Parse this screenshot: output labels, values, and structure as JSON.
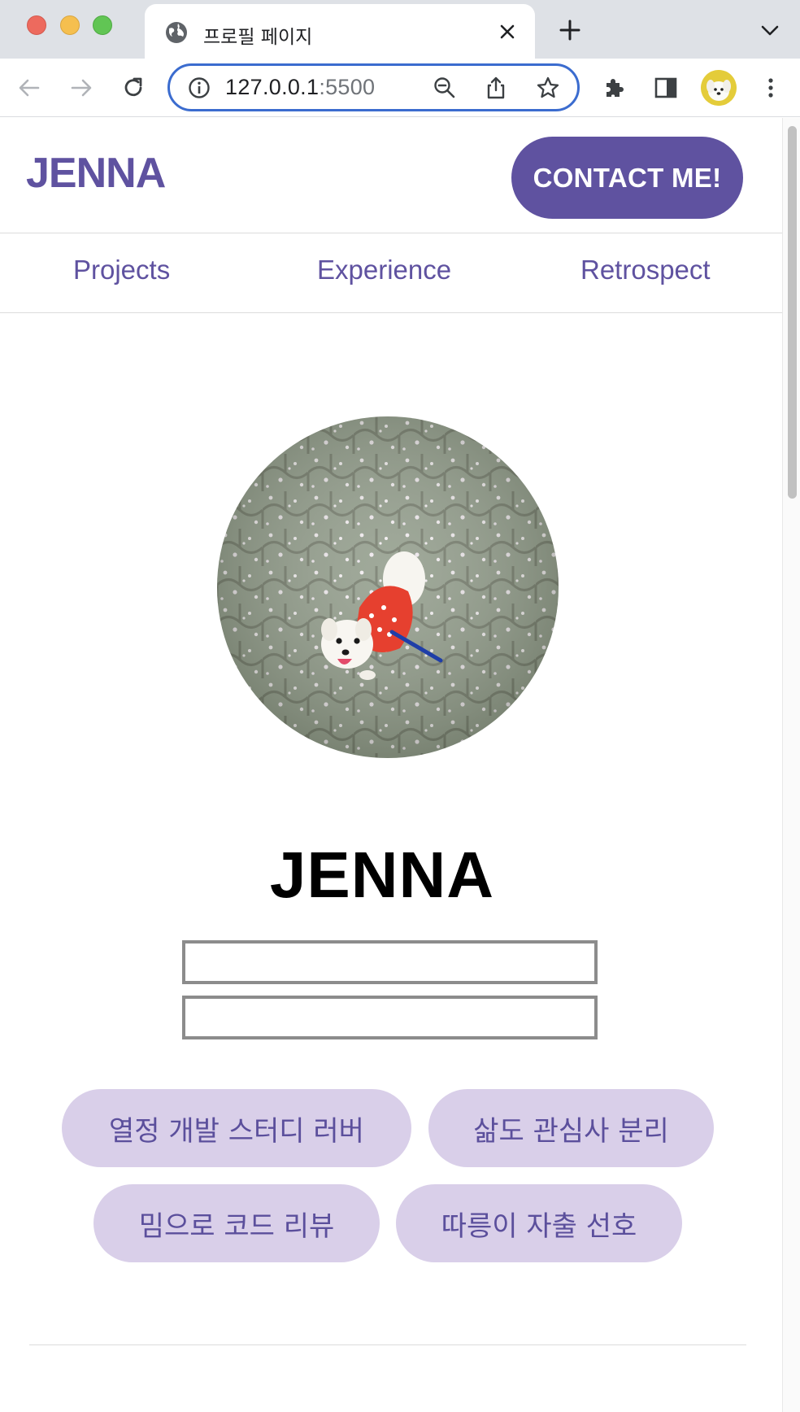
{
  "browser": {
    "tab_title": "프로필 페이지",
    "url_host": "127.0.0.1",
    "url_port": ":5500"
  },
  "site": {
    "logo": "JENNA",
    "contact_label": "CONTACT ME!",
    "nav": [
      "Projects",
      "Experience",
      "Retrospect"
    ],
    "profile_name": "JENNA",
    "tags": [
      "열정 개발 스터디 러버",
      "삶도 관심사 분리",
      "밈으로 코드 리뷰",
      "따릉이 자출 선호"
    ]
  },
  "colors": {
    "brand": "#5f52a0",
    "tag_bg": "#d9cfe9",
    "tag_text": "#5b4f9c"
  },
  "icons": [
    "globe-icon",
    "close-icon",
    "plus-icon",
    "chevron-down-icon",
    "back-arrow-icon",
    "forward-arrow-icon",
    "reload-icon",
    "info-icon",
    "zoom-out-icon",
    "share-icon",
    "star-icon",
    "extensions-icon",
    "side-panel-icon",
    "more-vert-icon"
  ]
}
